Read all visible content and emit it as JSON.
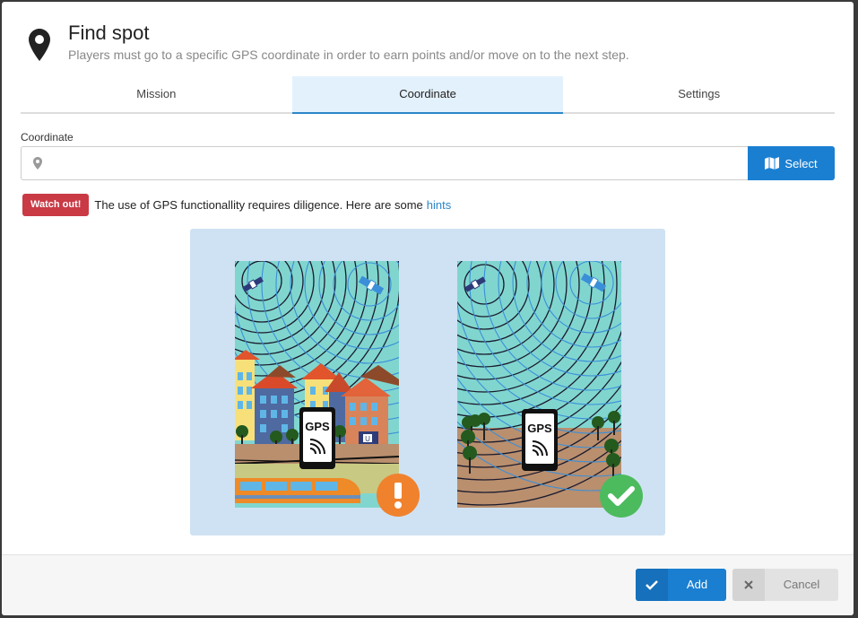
{
  "header": {
    "title": "Find spot",
    "subtitle": "Players must go to a specific GPS coordinate in order to earn points and/or move on to the next step."
  },
  "tabs": [
    {
      "label": "Mission",
      "active": false
    },
    {
      "label": "Coordinate",
      "active": true
    },
    {
      "label": "Settings",
      "active": false
    }
  ],
  "coordinate": {
    "label": "Coordinate",
    "value": "",
    "placeholder": "",
    "select_label": "Select"
  },
  "alert": {
    "badge": "Watch out!",
    "text": "The use of GPS functionallity requires diligence. Here are some",
    "link": "hints"
  },
  "illustration": {
    "left_phone_text": "GPS",
    "right_phone_text": "GPS",
    "station_sign": "U"
  },
  "footer": {
    "add_label": "Add",
    "cancel_label": "Cancel"
  },
  "colors": {
    "primary": "#1a7fd1",
    "danger": "#c93a45",
    "warning": "#f0822e",
    "success": "#4cbb5e"
  }
}
